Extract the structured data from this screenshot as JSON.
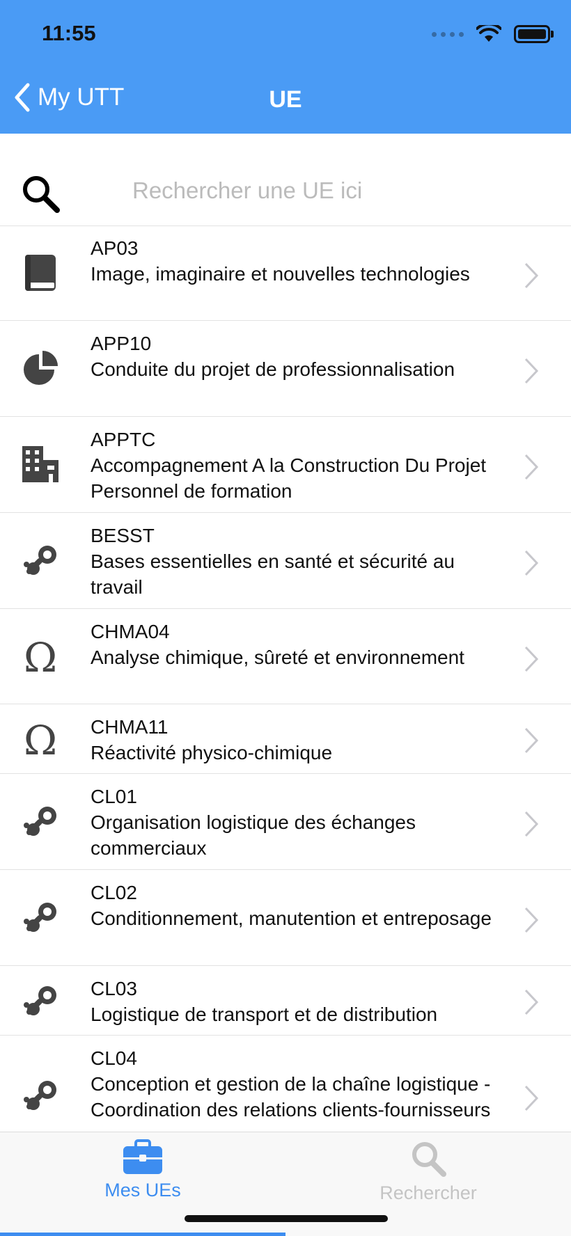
{
  "status": {
    "time": "11:55"
  },
  "nav": {
    "back_label": "My UTT",
    "title": "UE"
  },
  "search": {
    "placeholder": "Rechercher une UE ici",
    "value": ""
  },
  "list": {
    "items": [
      {
        "code": "AP03",
        "title": "Image, imaginaire et nouvelles technologies",
        "icon": "book-icon"
      },
      {
        "code": "APP10",
        "title": "Conduite du projet de professionnalisation",
        "icon": "pie-chart-icon"
      },
      {
        "code": "APPTC",
        "title": "Accompagnement A la Construction Du Projet Personnel de formation",
        "icon": "building-icon"
      },
      {
        "code": "BESST",
        "title": "Bases essentielles en santé et sécurité au travail",
        "icon": "steam-icon"
      },
      {
        "code": "CHMA04",
        "title": "Analyse chimique, sûreté et environnement",
        "icon": "omega-icon"
      },
      {
        "code": "CHMA11",
        "title": "Réactivité physico-chimique",
        "icon": "omega-icon"
      },
      {
        "code": "CL01",
        "title": "Organisation logistique des échanges commerciaux",
        "icon": "steam-icon"
      },
      {
        "code": "CL02",
        "title": "Conditionnement, manutention et entreposage",
        "icon": "steam-icon"
      },
      {
        "code": "CL03",
        "title": "Logistique de transport et de distribution",
        "icon": "steam-icon"
      },
      {
        "code": "CL04",
        "title": "Conception et gestion de la chaîne logistique - Coordination des relations clients-fournisseurs",
        "icon": "steam-icon"
      }
    ]
  },
  "tabbar": {
    "tabs": [
      {
        "label": "Mes UEs",
        "icon": "briefcase-icon",
        "active": true
      },
      {
        "label": "Rechercher",
        "icon": "search-icon",
        "active": false
      }
    ]
  },
  "colors": {
    "header": "#4a9bf5",
    "accent": "#3d8df0",
    "icon_gray": "#444444",
    "chevron": "#c7c7cc"
  }
}
